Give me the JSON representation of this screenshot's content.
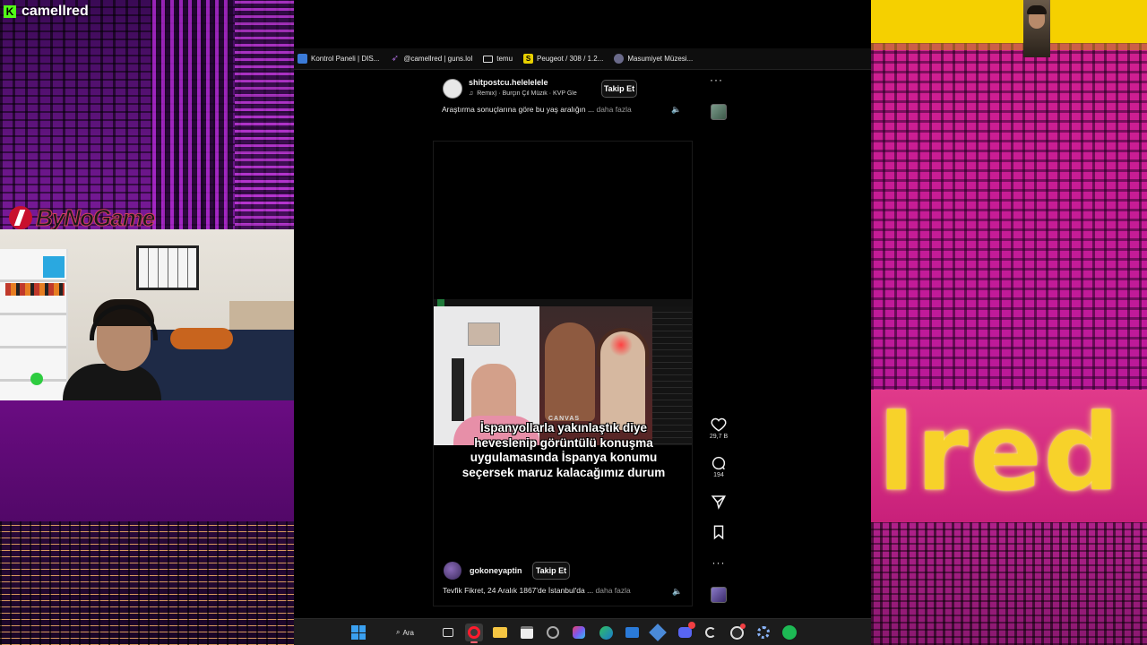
{
  "overlay_left": {
    "channel_name": "camellred",
    "sponsor": "ByNoGame"
  },
  "overlay_right": {
    "sign_text": "lred"
  },
  "bookmarks": [
    {
      "label": "Kontrol Paneli | DIS...",
      "icon": "panel-icon"
    },
    {
      "label": "@camellred | guns.lol",
      "icon": "gunslol-icon"
    },
    {
      "label": "temu",
      "icon": "folder-icon"
    },
    {
      "label": "Peugeot / 308 / 1.2...",
      "icon": "sahibinden-icon"
    },
    {
      "label": "Masumiyet Müzesi...",
      "icon": "museum-icon"
    }
  ],
  "post_top": {
    "username": "shitpostcu.helelelele",
    "music": "Remix) · Burçin Çil Müzik · KVP Gle",
    "follow_label": "Takip Et",
    "caption": "Araştırma sonuçlarına göre bu yaş aralığın ...",
    "more_label": "daha fazla"
  },
  "reel": {
    "video_label": "CANVAS",
    "subtitle_lines": [
      "İspanyollarla yakınlaştık diye",
      "heveslenip görüntülü konuşma",
      "uygulamasında İspanya konumu",
      "seçersek maruz kalacağımız durum"
    ],
    "username": "gokoneyaptin",
    "follow_label": "Takip Et",
    "caption": "Tevfik Fikret, 24 Aralık 1867'de İstanbul'da ...",
    "more_label": "daha fazla"
  },
  "actions": {
    "likes": "29,7 B",
    "comments": "194"
  },
  "taskbar": {
    "search_label": "Ara"
  }
}
